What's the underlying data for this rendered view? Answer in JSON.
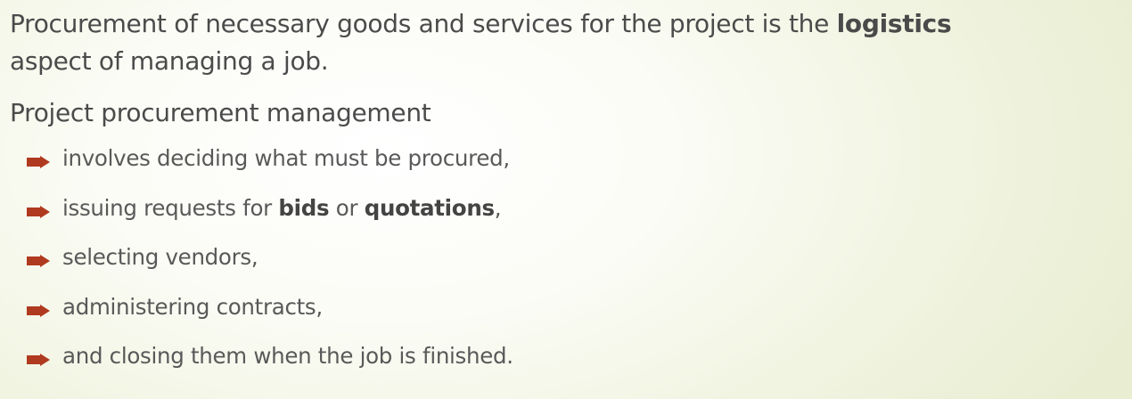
{
  "paragraph1": {
    "text_before": "Procurement of necessary goods and services for the project is the ",
    "bold": "logistics",
    "line2": "aspect of managing a job."
  },
  "paragraph2": {
    "text": "Project procurement management"
  },
  "bullet_icon_color": "#b03a1f",
  "bullets": [
    {
      "text": "involves deciding what must be procured,"
    },
    {
      "pre": "issuing requests for ",
      "bold1": "bids",
      "mid": " or ",
      "bold2": "quotations",
      "post": ","
    },
    {
      "text": "selecting vendors,"
    },
    {
      "text": "administering contracts,"
    },
    {
      "text": "and closing them when the job is finished."
    }
  ]
}
